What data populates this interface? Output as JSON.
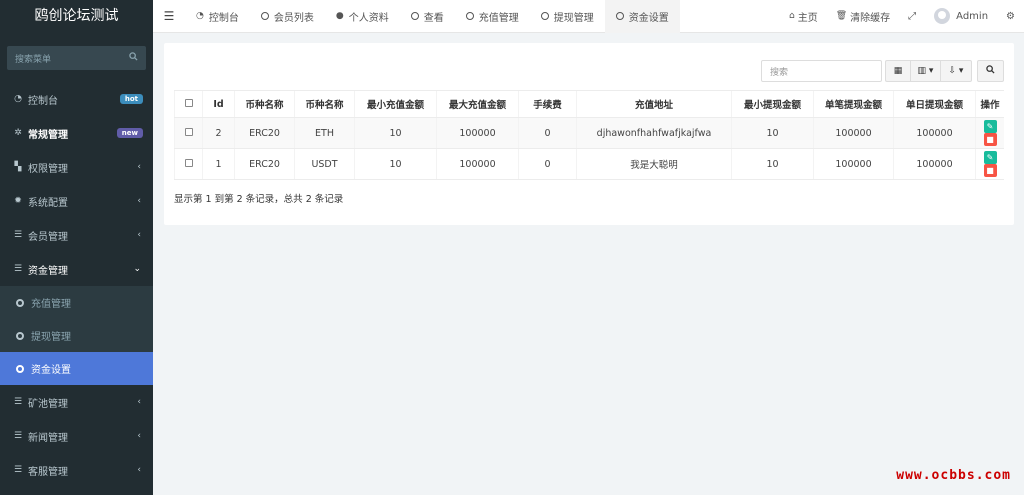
{
  "app": {
    "title": "鸥创论坛测试"
  },
  "sidebar": {
    "search_placeholder": "搜索菜单",
    "items": [
      {
        "label": "控制台",
        "icon": "dashboard-icon",
        "badge": "hot",
        "badge_color": "#3c8dbc"
      },
      {
        "label": "常规管理",
        "icon": "cogs-icon",
        "badge": "new",
        "badge_color": "#605ca8"
      },
      {
        "label": "权限管理",
        "icon": "group-icon"
      },
      {
        "label": "系统配置",
        "icon": "gear-icon"
      },
      {
        "label": "会员管理",
        "icon": "list-icon"
      },
      {
        "label": "资金管理",
        "icon": "list-icon",
        "expanded": true
      },
      {
        "label": "矿池管理",
        "icon": "list-icon"
      },
      {
        "label": "新闻管理",
        "icon": "list-icon"
      },
      {
        "label": "客服管理",
        "icon": "list-icon"
      }
    ],
    "subitems": [
      {
        "label": "充值管理"
      },
      {
        "label": "提现管理"
      },
      {
        "label": "资金设置",
        "active": true
      }
    ]
  },
  "topbar": {
    "tabs": [
      {
        "label": "控制台",
        "icon": "dashboard-icon"
      },
      {
        "label": "会员列表",
        "icon": "circle-icon"
      },
      {
        "label": "个人资料",
        "icon": "user-icon"
      },
      {
        "label": "查看",
        "icon": "circle-icon"
      },
      {
        "label": "充值管理",
        "icon": "circle-icon"
      },
      {
        "label": "提现管理",
        "icon": "circle-icon"
      },
      {
        "label": "资金设置",
        "icon": "circle-icon",
        "active": true
      }
    ],
    "home_label": "主页",
    "clear_cache_label": "清除缓存",
    "user_name": "Admin"
  },
  "toolbar": {
    "search_placeholder": "搜索"
  },
  "table": {
    "columns": [
      "Id",
      "币种名称",
      "币种名称",
      "最小充值金额",
      "最大充值金额",
      "手续费",
      "充值地址",
      "最小提现金额",
      "单笔提现金额",
      "单日提现金额",
      "操作"
    ],
    "rows": [
      [
        "2",
        "ERC20",
        "ETH",
        "10",
        "100000",
        "0",
        "djhawonfhahfwafjkajfwa",
        "10",
        "100000",
        "100000"
      ],
      [
        "1",
        "ERC20",
        "USDT",
        "10",
        "100000",
        "0",
        "我是大聪明",
        "10",
        "100000",
        "100000"
      ]
    ]
  },
  "pager": {
    "info": "显示第 1 到第 2 条记录，总共 2 条记录"
  },
  "watermark": "www.ocbbs.com",
  "colors": {
    "sidebar_bg": "#222d32",
    "active_blue": "#4e78d9",
    "edit_green": "#18bc9c",
    "delete_red": "#f75444"
  }
}
